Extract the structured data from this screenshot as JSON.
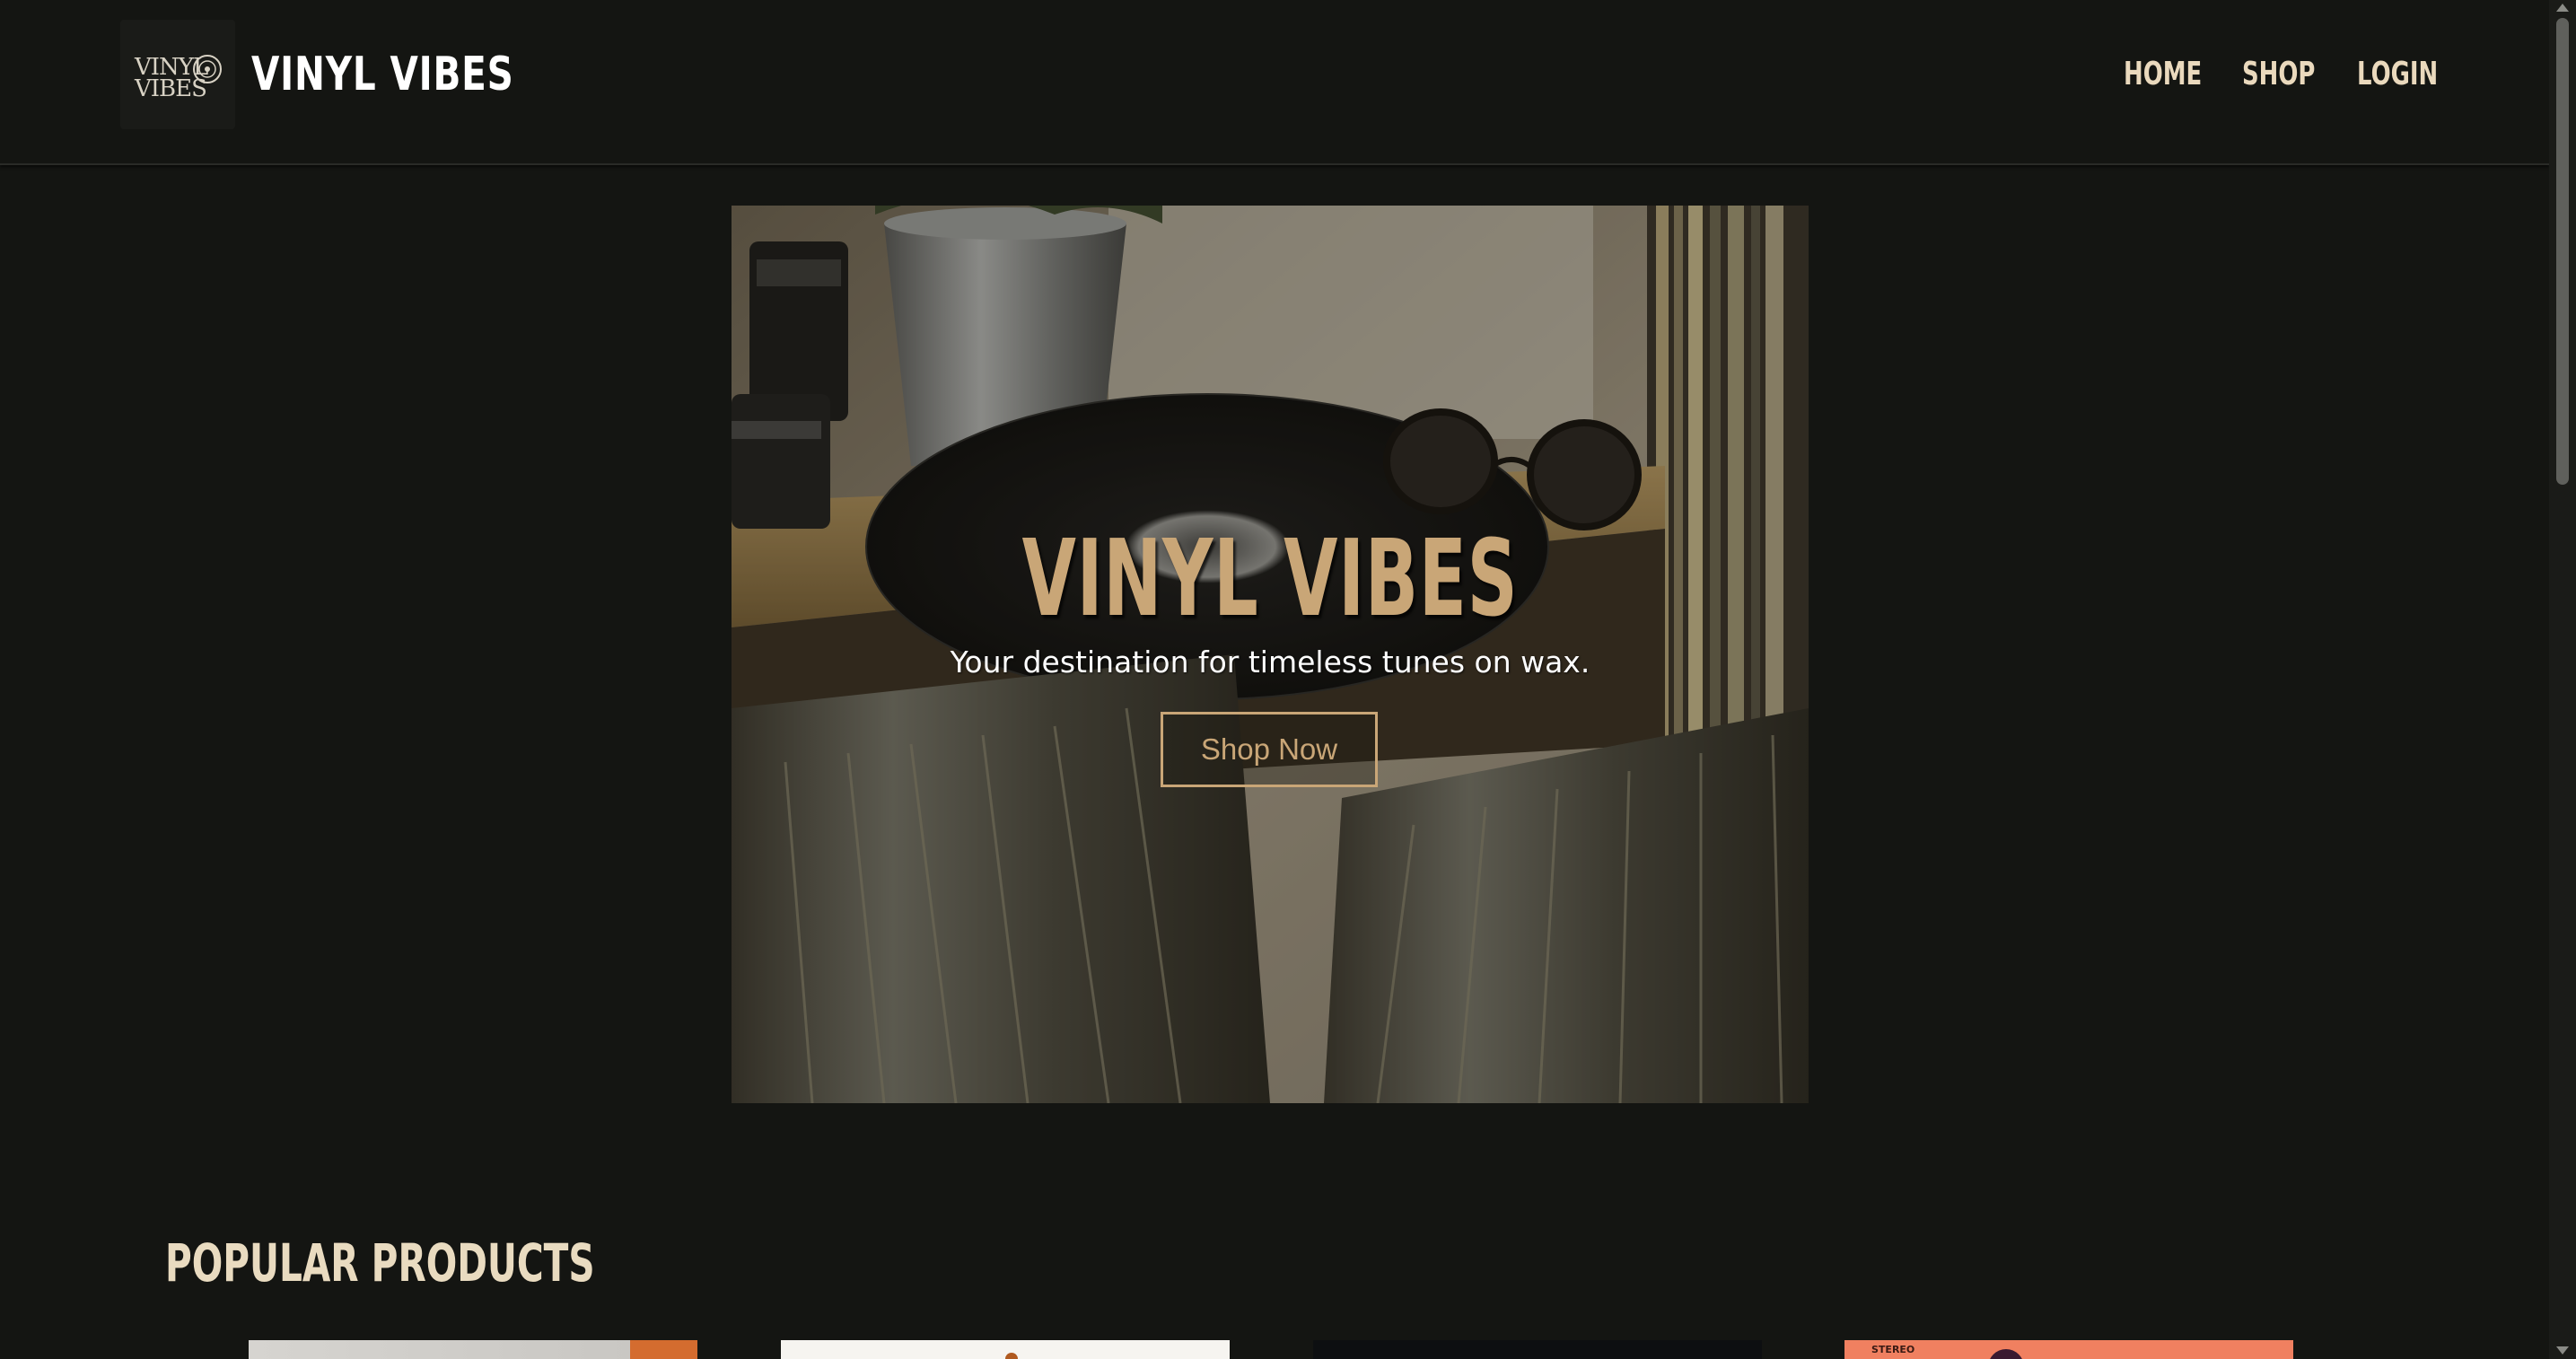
{
  "header": {
    "logo": {
      "line1": "VINYL",
      "line2": "VIBES",
      "icon": "vinyl-record-icon"
    },
    "brand": "VINYL VIBES",
    "nav": [
      {
        "label": "HOME"
      },
      {
        "label": "SHOP"
      },
      {
        "label": "LOGIN"
      }
    ]
  },
  "hero": {
    "image": "photo of a vinyl record on a wooden shelf with stacked records, camera lenses, sunglasses and a metal plant pot",
    "title": "VINYL VIBES",
    "subtitle": "Your destination for timeless tunes on wax.",
    "cta": "Shop Now"
  },
  "popular": {
    "heading": "POPULAR PRODUCTS",
    "products": [
      {
        "tag": "",
        "cover": "grey album cover with orange stripe"
      },
      {
        "tag": "",
        "cover": "white album cover"
      },
      {
        "tag": "",
        "cover": "black album cover"
      },
      {
        "tag": "STEREO",
        "cover": "coral red album cover"
      }
    ]
  },
  "colors": {
    "background": "#141512",
    "accent": "#c9a677",
    "nav_text": "#ead9bd",
    "heading_text": "#e9dbc0"
  }
}
